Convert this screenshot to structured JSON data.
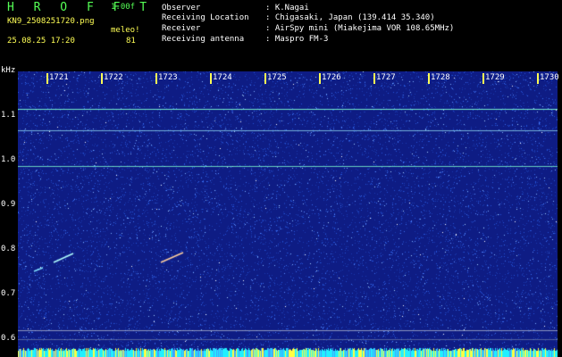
{
  "header": {
    "brand": "H R O F F T",
    "version": "1.00f",
    "filename": "KN9_2508251720.png",
    "meleo_label": "meleo!",
    "date": "25.08.25 17:20",
    "count": "81"
  },
  "info": {
    "observer_label": "Observer",
    "observer_value": ": K.Nagai",
    "location_label": "Receiving Location",
    "location_value": ": Chigasaki, Japan (139.414 35.340)",
    "receiver_label": "Receiver",
    "receiver_value": ": AirSpy mini (Miakejima VOR 108.65MHz)",
    "antenna_label": "Receiving antenna",
    "antenna_value": ": Maspro FM-3"
  },
  "axis": {
    "unit": "kHz",
    "y_ticks": [
      "1.1",
      "1.0",
      "0.9",
      "0.8",
      "0.7",
      "0.6"
    ],
    "time_ticks": [
      "1721",
      "1722",
      "1723",
      "1724",
      "1725",
      "1726",
      "1727",
      "1728",
      "1729",
      "1730"
    ]
  },
  "colors": {
    "background": "#0e1c84",
    "accent_green": "#55ff55",
    "accent_yellow": "#ffff55"
  }
}
